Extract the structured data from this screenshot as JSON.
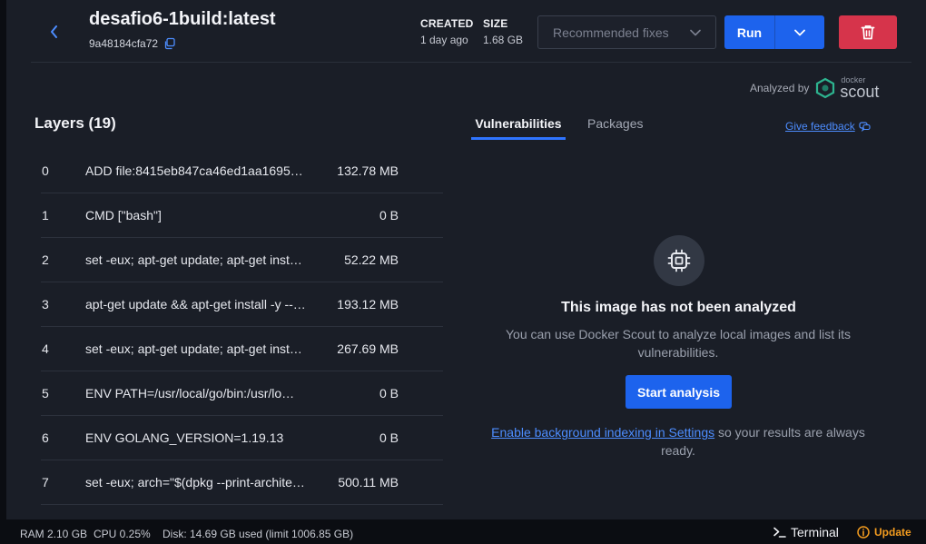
{
  "header": {
    "title": "desafio6-1build:latest",
    "image_id": "9a48184cfa72",
    "created_label": "CREATED",
    "created_value": "1 day ago",
    "size_label": "SIZE",
    "size_value": "1.68 GB",
    "recommended_fixes": "Recommended fixes",
    "run_label": "Run"
  },
  "analyzed": {
    "label": "Analyzed by",
    "brand_small": "docker",
    "brand_big": "scout"
  },
  "layers": {
    "title": "Layers (19)",
    "rows": [
      {
        "idx": "0",
        "cmd": "ADD file:8415eb847ca46ed1aa1695…",
        "size": "132.78 MB"
      },
      {
        "idx": "1",
        "cmd": "CMD [\"bash\"]",
        "size": "0 B"
      },
      {
        "idx": "2",
        "cmd": "set -eux; apt-get update; apt-get inst…",
        "size": "52.22 MB"
      },
      {
        "idx": "3",
        "cmd": "apt-get update && apt-get install -y --…",
        "size": "193.12 MB"
      },
      {
        "idx": "4",
        "cmd": "set -eux; apt-get update; apt-get inst…",
        "size": "267.69 MB"
      },
      {
        "idx": "5",
        "cmd": "ENV PATH=/usr/local/go/bin:/usr/lo…",
        "size": "0 B"
      },
      {
        "idx": "6",
        "cmd": "ENV GOLANG_VERSION=1.19.13",
        "size": "0 B"
      },
      {
        "idx": "7",
        "cmd": "set -eux; arch=\"$(dpkg --print-archite…",
        "size": "500.11 MB"
      }
    ]
  },
  "tabs": {
    "vulnerabilities": "Vulnerabilities",
    "packages": "Packages"
  },
  "feedback": "Give feedback",
  "empty_state": {
    "title": "This image has not been analyzed",
    "description": "You can use Docker Scout to analyze local images and list its vulnerabilities.",
    "button": "Start analysis",
    "link": "Enable background indexing in Settings",
    "link_suffix": " so your results are always ready."
  },
  "statusbar": {
    "ram": "RAM 2.10 GB",
    "cpu": "CPU 0.25%",
    "disk": "Disk: 14.69 GB used (limit 1006.85 GB)",
    "terminal": "Terminal",
    "update": "Update"
  },
  "icons": {
    "back": "chevron-left-icon",
    "copy": "copy-icon",
    "dropdown": "chevron-down-icon",
    "delete": "trash-icon",
    "scout": "docker-scout-logo",
    "chip": "chip-icon",
    "external": "external-link-icon",
    "terminal": "terminal-icon",
    "update": "info-circle-icon"
  },
  "colors": {
    "accent": "#1d63ed",
    "danger": "#d6344b",
    "warning": "#f29b1f",
    "link": "#4d8dff",
    "scout": "#2db48f"
  }
}
